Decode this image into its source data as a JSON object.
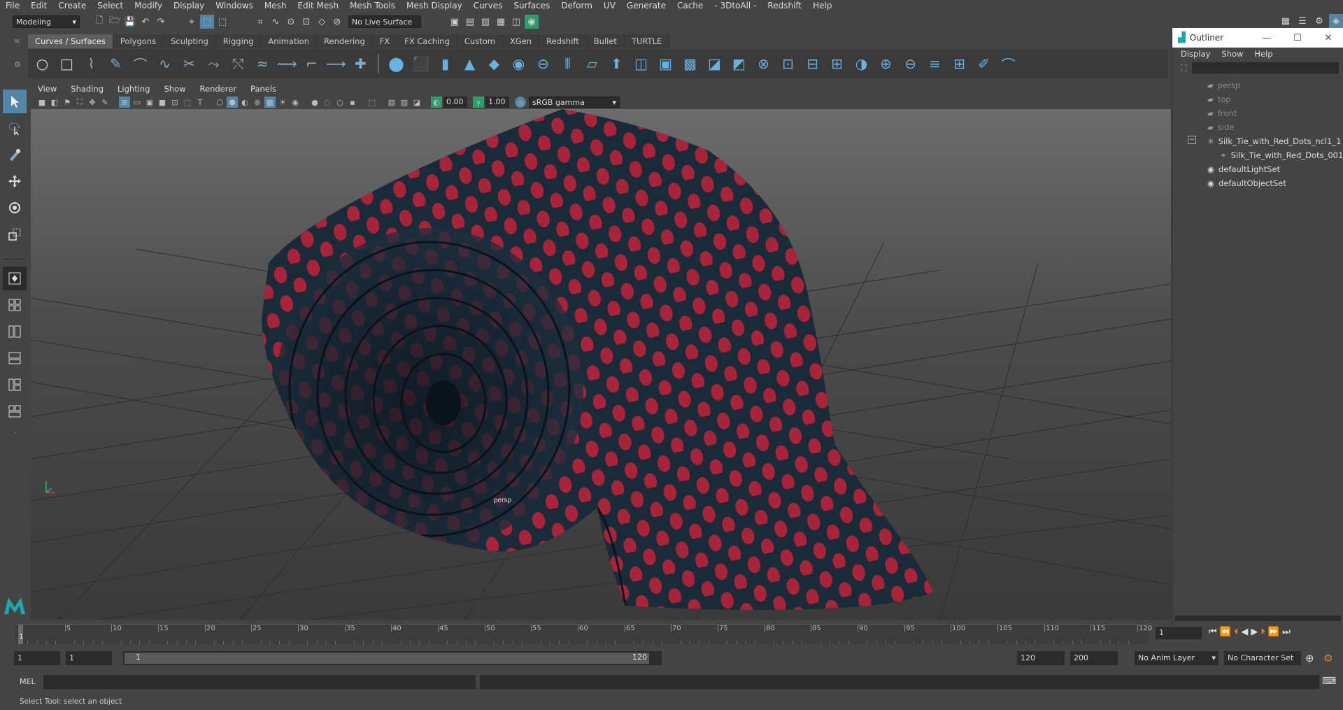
{
  "menubar": [
    "File",
    "Edit",
    "Create",
    "Select",
    "Modify",
    "Display",
    "Windows",
    "Mesh",
    "Edit Mesh",
    "Mesh Tools",
    "Mesh Display",
    "Curves",
    "Surfaces",
    "Deform",
    "UV",
    "Generate",
    "Cache",
    "- 3DtoAll -",
    "Redshift",
    "Help"
  ],
  "statusline": {
    "workspace": "Modeling",
    "live_surface": "No Live Surface"
  },
  "shelf_tabs": [
    {
      "label": "Curves / Surfaces",
      "active": true
    },
    {
      "label": "Polygons"
    },
    {
      "label": "Sculpting"
    },
    {
      "label": "Rigging"
    },
    {
      "label": "Animation"
    },
    {
      "label": "Rendering"
    },
    {
      "label": "FX"
    },
    {
      "label": "FX Caching"
    },
    {
      "label": "Custom"
    },
    {
      "label": "XGen"
    },
    {
      "label": "Redshift"
    },
    {
      "label": "Bullet"
    },
    {
      "label": "TURTLE"
    }
  ],
  "shelf_icons": [
    "circle-icon",
    "square-icon",
    "ep-curve-icon",
    "pencil-curve-icon",
    "bezier-icon",
    "arc-icon",
    "cut-curve-icon",
    "curve-attach-icon",
    "curve-detach-icon",
    "curve-rebuild-icon",
    "curve-offset-icon",
    "curve-fillet-icon",
    "curve-extend-icon",
    "curve-insert-icon",
    "sphere-icon",
    "cube-icon",
    "cylinder-icon",
    "cone-icon",
    "plane-icon",
    "torus-icon",
    "revolve-icon",
    "loft-icon",
    "planar-icon",
    "extrude-icon",
    "birail-icon",
    "boundary-icon",
    "square-surface-icon",
    "bevel-icon",
    "bevel-plus-icon",
    "intersect-icon",
    "project-icon",
    "trim-icon",
    "untrim-icon",
    "open-close-icon",
    "attach-icon",
    "detach-icon",
    "align-icon",
    "stitch-icon",
    "sculpt-icon",
    "surface-fillet-icon"
  ],
  "panel_menu": [
    "View",
    "Shading",
    "Lighting",
    "Show",
    "Renderer",
    "Panels"
  ],
  "panel_toolbar": {
    "exposure": "0.00",
    "gamma": "1.00",
    "color_space": "sRGB gamma"
  },
  "viewport": {
    "camera_label": "persp",
    "tie_color": "#1b2a38",
    "dot_color": "#b0243a"
  },
  "outliner": {
    "title": "Outliner",
    "menu": [
      "Display",
      "Show",
      "Help"
    ],
    "items": [
      {
        "label": "persp",
        "dim": true
      },
      {
        "label": "top",
        "dim": true
      },
      {
        "label": "front",
        "dim": true
      },
      {
        "label": "side",
        "dim": true
      },
      {
        "label": "Silk_Tie_with_Red_Dots_ncl1_1"
      },
      {
        "label": "Silk_Tie_with_Red_Dots_001"
      },
      {
        "label": "defaultLightSet"
      },
      {
        "label": "defaultObjectSet"
      }
    ]
  },
  "timeslider": {
    "ticks": [
      "5",
      "10",
      "15",
      "20",
      "25",
      "30",
      "35",
      "40",
      "45",
      "50",
      "55",
      "60",
      "65",
      "70",
      "75",
      "80",
      "85",
      "90",
      "95",
      "100",
      "105",
      "110",
      "115",
      "120"
    ],
    "current_frame": "1",
    "current_marker": "1"
  },
  "range": {
    "start": "1",
    "playback_start": "1",
    "slider_start": "1",
    "slider_end": "120",
    "playback_end": "120",
    "end": "200",
    "anim_layer": "No Anim Layer",
    "character_set": "No Character Set"
  },
  "cmdline": {
    "label": "MEL"
  },
  "helpline": {
    "text": "Select Tool: select an object"
  }
}
